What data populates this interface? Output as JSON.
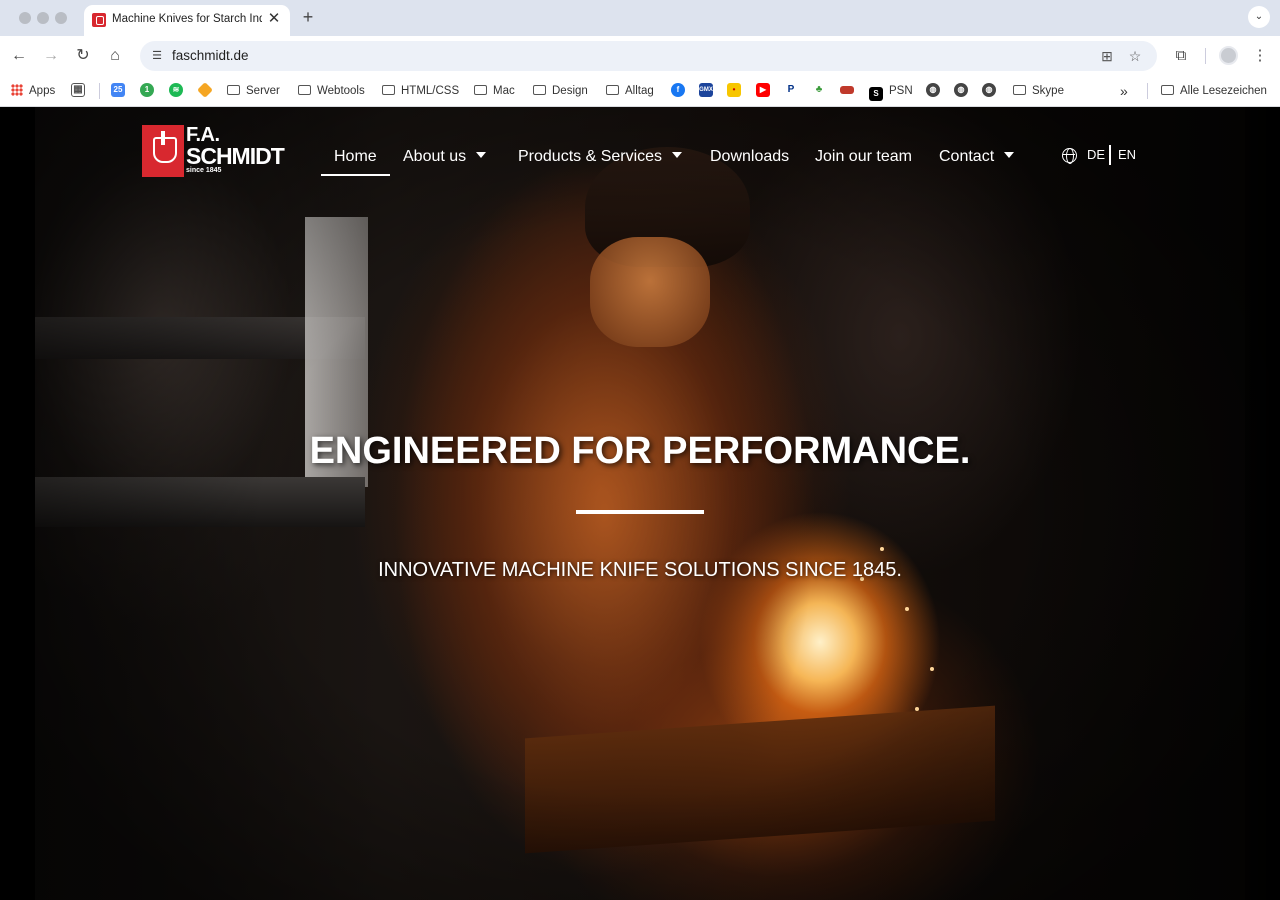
{
  "browser": {
    "tab_title": "Machine Knives for Starch Ind",
    "tab_close": "✕",
    "new_tab": "+",
    "url": "faschmidt.de",
    "tab_menu": "⌄"
  },
  "bookmarks": {
    "apps_label": "Apps",
    "items": [
      {
        "label": "Server"
      },
      {
        "label": "Webtools"
      },
      {
        "label": "HTML/CSS"
      },
      {
        "label": "Mac"
      },
      {
        "label": "Design"
      },
      {
        "label": "Alltag"
      },
      {
        "label": "PSN"
      },
      {
        "label": "Skype"
      }
    ],
    "icon_badges": {
      "calendar": "25",
      "green": "1",
      "gmx": "GMX",
      "psn": "S"
    },
    "overflow": "»",
    "all_bookmarks": "Alle Lesezeichen"
  },
  "site": {
    "logo": {
      "line1": "F.A.",
      "line2": "SCHMIDT",
      "line3": "since 1845"
    },
    "nav": [
      {
        "label": "Home",
        "active": true
      },
      {
        "label": "About us",
        "dropdown": true
      },
      {
        "label": "Products & Services",
        "dropdown": true
      },
      {
        "label": "Downloads"
      },
      {
        "label": "Join our team"
      },
      {
        "label": "Contact",
        "dropdown": true
      }
    ],
    "lang": {
      "de": "DE",
      "en": "EN"
    },
    "hero": {
      "title": "ENGINEERED FOR PERFORMANCE.",
      "subtitle": "INNOVATIVE MACHINE KNIFE SOLUTIONS SINCE 1845."
    }
  },
  "colors": {
    "brand_red": "#d8282f",
    "chrome_bg": "#dde3ee",
    "omnibox_bg": "#edf1f8"
  }
}
